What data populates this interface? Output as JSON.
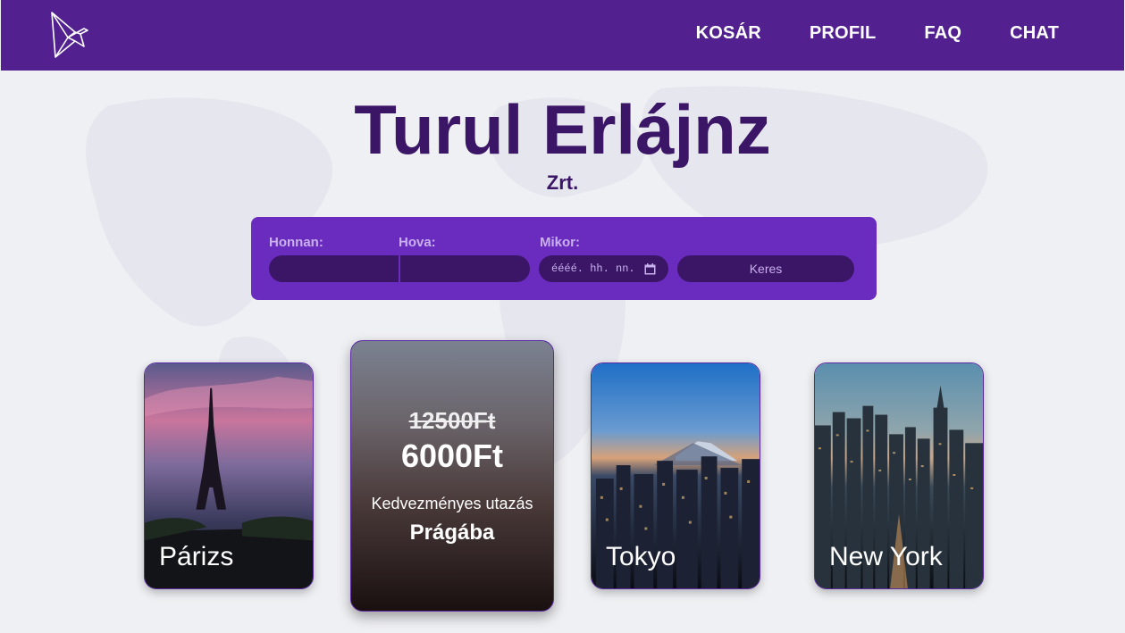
{
  "nav": {
    "items": [
      {
        "label": "KOSÁR"
      },
      {
        "label": "PROFIL"
      },
      {
        "label": "FAQ"
      },
      {
        "label": "CHAT"
      }
    ]
  },
  "hero": {
    "title": "Turul Erlájnz",
    "subtitle": "Zrt."
  },
  "search": {
    "from_label": "Honnan:",
    "to_label": "Hova:",
    "date_label": "Mikor:",
    "date_placeholder": "éééé. hh. nn.",
    "button_label": "Keres"
  },
  "cards": {
    "paris": {
      "label": "Párizs"
    },
    "promo": {
      "old_price": "12500Ft",
      "new_price": "6000Ft",
      "description": "Kedvezményes utazás",
      "destination": "Prágába"
    },
    "tokyo": {
      "label": "Tokyo"
    },
    "newyork": {
      "label": "New York"
    }
  },
  "colors": {
    "navbar": "#52218f",
    "title": "#3b1566",
    "search_panel": "#6a2bbf",
    "input": "#3b1566"
  },
  "icons": [
    "bird-logo-icon",
    "calendar-icon"
  ]
}
